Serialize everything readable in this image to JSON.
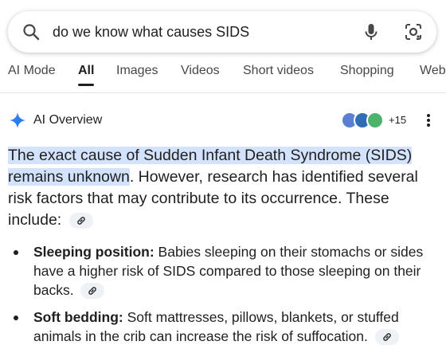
{
  "search": {
    "query": "do we know what causes SIDS"
  },
  "tabs": [
    "AI Mode",
    "All",
    "Images",
    "Videos",
    "Short videos",
    "Shopping",
    "Web"
  ],
  "ai_overview": {
    "title": "AI Overview",
    "sources_count": "+15",
    "highlighted": "The exact cause of Sudden Infant Death Syndrome (SIDS) remains unknown",
    "intro_rest": ". However, research has identified several risk factors that may contribute to its occurrence. These include:",
    "bullets": [
      {
        "term": "Sleeping position:",
        "text": " Babies sleeping on their stomachs or sides have a higher risk of SIDS compared to those sleeping on their backs."
      },
      {
        "term": "Soft bedding:",
        "text": " Soft mattresses, pillows, blankets, or stuffed animals in the crib can increase the risk of suffocation."
      }
    ]
  },
  "colors": {
    "highlight": "#d3e3fd",
    "accent_blue": "#1a73e8",
    "chip_bg": "#eef1f6"
  },
  "icons": [
    "search-icon",
    "mic-icon",
    "lens-icon",
    "ai-sparkle-icon",
    "more-vert-icon",
    "link-icon"
  ]
}
